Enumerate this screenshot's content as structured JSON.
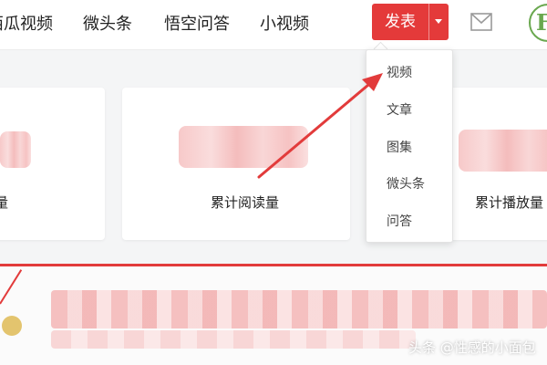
{
  "top_nav": {
    "items": [
      {
        "label": "西瓜视频"
      },
      {
        "label": "微头条"
      },
      {
        "label": "悟空问答"
      },
      {
        "label": "小视频"
      }
    ],
    "publish_label": "发表",
    "icons": {
      "caret": "caret-down-icon",
      "mail": "mail-icon",
      "logo": "site-logo"
    }
  },
  "stats": {
    "cards": [
      {
        "label": "量"
      },
      {
        "label": "累计阅读量"
      },
      {
        "label": "累计播放量"
      }
    ]
  },
  "publish_menu": {
    "items": [
      {
        "label": "视频"
      },
      {
        "label": "文章"
      },
      {
        "label": "图集"
      },
      {
        "label": "微头条"
      },
      {
        "label": "问答"
      }
    ]
  },
  "watermark": "头条 @性感的小面包",
  "colors": {
    "accent": "#e43a3a",
    "background": "#f4f5f6",
    "card": "#ffffff",
    "annotation": "#e23b3b"
  }
}
